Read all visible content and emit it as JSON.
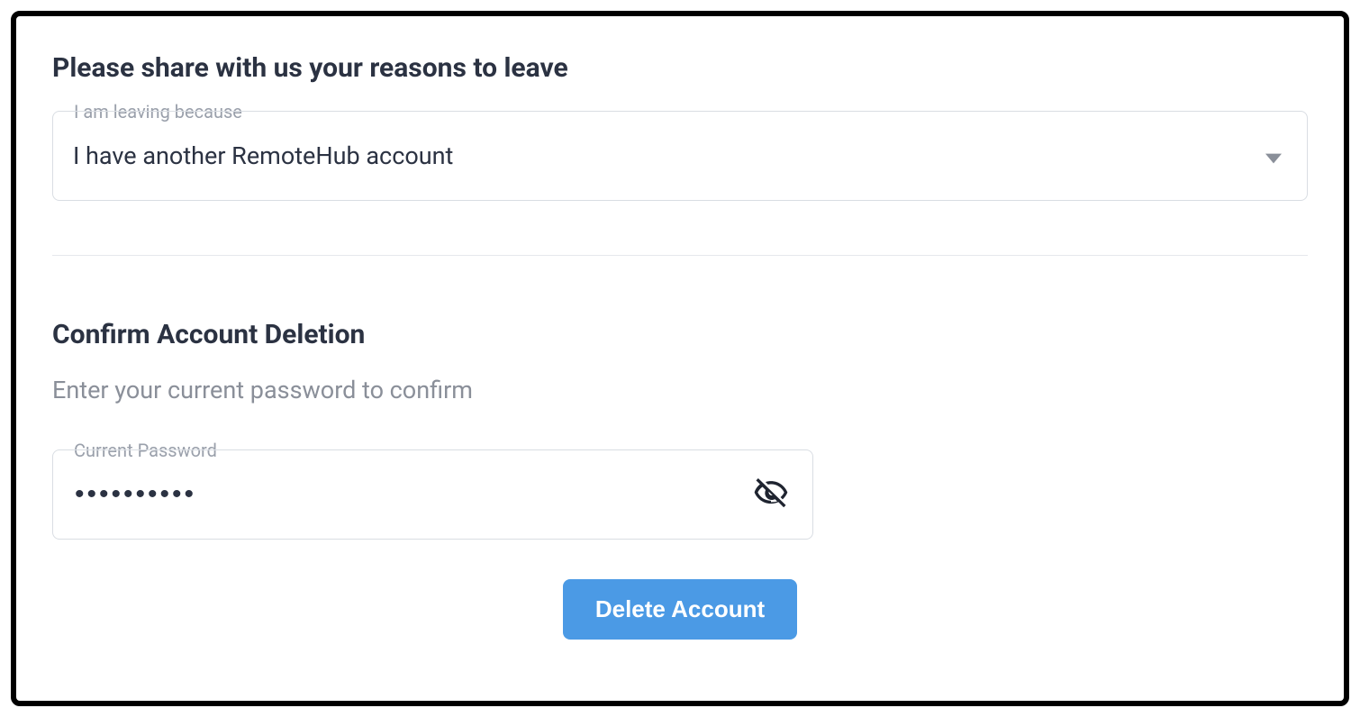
{
  "reason_section": {
    "title": "Please share with us your reasons to leave",
    "field_label": "I am leaving because",
    "selected_value": "I have another RemoteHub account"
  },
  "confirm_section": {
    "title": "Confirm Account Deletion",
    "subtitle": "Enter your current password to confirm",
    "password_label": "Current Password",
    "password_value": "••••••••••",
    "delete_button_label": "Delete Account"
  }
}
